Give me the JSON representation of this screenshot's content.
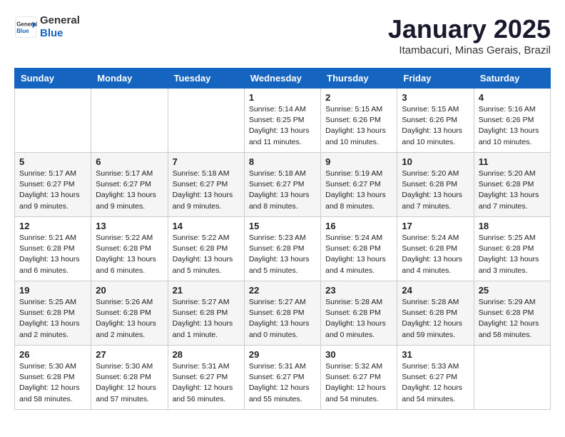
{
  "logo": {
    "general": "General",
    "blue": "Blue"
  },
  "header": {
    "month": "January 2025",
    "location": "Itambacuri, Minas Gerais, Brazil"
  },
  "days_of_week": [
    "Sunday",
    "Monday",
    "Tuesday",
    "Wednesday",
    "Thursday",
    "Friday",
    "Saturday"
  ],
  "weeks": [
    [
      {
        "day": "",
        "info": ""
      },
      {
        "day": "",
        "info": ""
      },
      {
        "day": "",
        "info": ""
      },
      {
        "day": "1",
        "info": "Sunrise: 5:14 AM\nSunset: 6:25 PM\nDaylight: 13 hours\nand 11 minutes."
      },
      {
        "day": "2",
        "info": "Sunrise: 5:15 AM\nSunset: 6:26 PM\nDaylight: 13 hours\nand 10 minutes."
      },
      {
        "day": "3",
        "info": "Sunrise: 5:15 AM\nSunset: 6:26 PM\nDaylight: 13 hours\nand 10 minutes."
      },
      {
        "day": "4",
        "info": "Sunrise: 5:16 AM\nSunset: 6:26 PM\nDaylight: 13 hours\nand 10 minutes."
      }
    ],
    [
      {
        "day": "5",
        "info": "Sunrise: 5:17 AM\nSunset: 6:27 PM\nDaylight: 13 hours\nand 9 minutes."
      },
      {
        "day": "6",
        "info": "Sunrise: 5:17 AM\nSunset: 6:27 PM\nDaylight: 13 hours\nand 9 minutes."
      },
      {
        "day": "7",
        "info": "Sunrise: 5:18 AM\nSunset: 6:27 PM\nDaylight: 13 hours\nand 9 minutes."
      },
      {
        "day": "8",
        "info": "Sunrise: 5:18 AM\nSunset: 6:27 PM\nDaylight: 13 hours\nand 8 minutes."
      },
      {
        "day": "9",
        "info": "Sunrise: 5:19 AM\nSunset: 6:27 PM\nDaylight: 13 hours\nand 8 minutes."
      },
      {
        "day": "10",
        "info": "Sunrise: 5:20 AM\nSunset: 6:28 PM\nDaylight: 13 hours\nand 7 minutes."
      },
      {
        "day": "11",
        "info": "Sunrise: 5:20 AM\nSunset: 6:28 PM\nDaylight: 13 hours\nand 7 minutes."
      }
    ],
    [
      {
        "day": "12",
        "info": "Sunrise: 5:21 AM\nSunset: 6:28 PM\nDaylight: 13 hours\nand 6 minutes."
      },
      {
        "day": "13",
        "info": "Sunrise: 5:22 AM\nSunset: 6:28 PM\nDaylight: 13 hours\nand 6 minutes."
      },
      {
        "day": "14",
        "info": "Sunrise: 5:22 AM\nSunset: 6:28 PM\nDaylight: 13 hours\nand 5 minutes."
      },
      {
        "day": "15",
        "info": "Sunrise: 5:23 AM\nSunset: 6:28 PM\nDaylight: 13 hours\nand 5 minutes."
      },
      {
        "day": "16",
        "info": "Sunrise: 5:24 AM\nSunset: 6:28 PM\nDaylight: 13 hours\nand 4 minutes."
      },
      {
        "day": "17",
        "info": "Sunrise: 5:24 AM\nSunset: 6:28 PM\nDaylight: 13 hours\nand 4 minutes."
      },
      {
        "day": "18",
        "info": "Sunrise: 5:25 AM\nSunset: 6:28 PM\nDaylight: 13 hours\nand 3 minutes."
      }
    ],
    [
      {
        "day": "19",
        "info": "Sunrise: 5:25 AM\nSunset: 6:28 PM\nDaylight: 13 hours\nand 2 minutes."
      },
      {
        "day": "20",
        "info": "Sunrise: 5:26 AM\nSunset: 6:28 PM\nDaylight: 13 hours\nand 2 minutes."
      },
      {
        "day": "21",
        "info": "Sunrise: 5:27 AM\nSunset: 6:28 PM\nDaylight: 13 hours\nand 1 minute."
      },
      {
        "day": "22",
        "info": "Sunrise: 5:27 AM\nSunset: 6:28 PM\nDaylight: 13 hours\nand 0 minutes."
      },
      {
        "day": "23",
        "info": "Sunrise: 5:28 AM\nSunset: 6:28 PM\nDaylight: 13 hours\nand 0 minutes."
      },
      {
        "day": "24",
        "info": "Sunrise: 5:28 AM\nSunset: 6:28 PM\nDaylight: 12 hours\nand 59 minutes."
      },
      {
        "day": "25",
        "info": "Sunrise: 5:29 AM\nSunset: 6:28 PM\nDaylight: 12 hours\nand 58 minutes."
      }
    ],
    [
      {
        "day": "26",
        "info": "Sunrise: 5:30 AM\nSunset: 6:28 PM\nDaylight: 12 hours\nand 58 minutes."
      },
      {
        "day": "27",
        "info": "Sunrise: 5:30 AM\nSunset: 6:28 PM\nDaylight: 12 hours\nand 57 minutes."
      },
      {
        "day": "28",
        "info": "Sunrise: 5:31 AM\nSunset: 6:27 PM\nDaylight: 12 hours\nand 56 minutes."
      },
      {
        "day": "29",
        "info": "Sunrise: 5:31 AM\nSunset: 6:27 PM\nDaylight: 12 hours\nand 55 minutes."
      },
      {
        "day": "30",
        "info": "Sunrise: 5:32 AM\nSunset: 6:27 PM\nDaylight: 12 hours\nand 54 minutes."
      },
      {
        "day": "31",
        "info": "Sunrise: 5:33 AM\nSunset: 6:27 PM\nDaylight: 12 hours\nand 54 minutes."
      },
      {
        "day": "",
        "info": ""
      }
    ]
  ]
}
